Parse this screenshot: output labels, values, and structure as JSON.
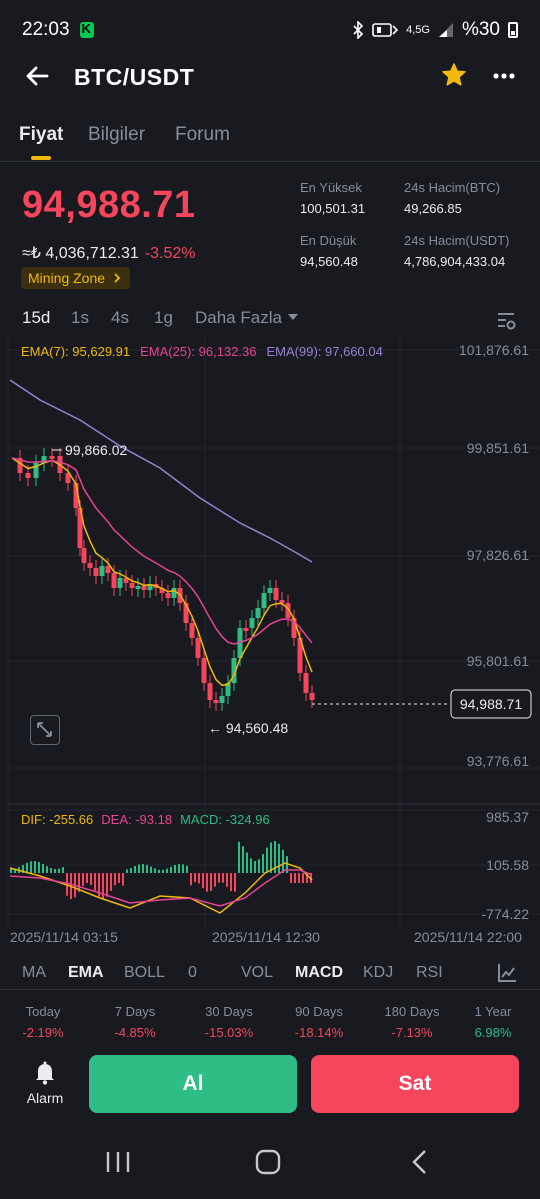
{
  "status_bar": {
    "time": "22:03",
    "network": "4,5G",
    "battery": "%30"
  },
  "header": {
    "title": "BTC/USDT"
  },
  "tabs": [
    {
      "label": "Fiyat",
      "active": true
    },
    {
      "label": "Bilgiler",
      "active": false
    },
    {
      "label": "Forum",
      "active": false
    }
  ],
  "price": {
    "last": "94,988.71",
    "fiat": "≈₺ 4,036,712.31",
    "change": "-3.52%",
    "mining_badge": "Mining Zone"
  },
  "stats": {
    "high_label": "En Yüksek",
    "high_value": "100,501.31",
    "low_label": "En Düşük",
    "low_value": "94,560.48",
    "vol_btc_label": "24s Hacim(BTC)",
    "vol_btc_value": "49,266.85",
    "vol_usdt_label": "24s Hacim(USDT)",
    "vol_usdt_value": "4,786,904,433.04"
  },
  "intervals": [
    {
      "label": "15d",
      "active": true
    },
    {
      "label": "1s",
      "active": false
    },
    {
      "label": "4s",
      "active": false
    },
    {
      "label": "1g",
      "active": false
    },
    {
      "label": "Daha Fazla",
      "active": false
    }
  ],
  "ema_legend": {
    "ema7": "EMA(7): 95,629.91",
    "ema25": "EMA(25): 96,132.36",
    "ema99": "EMA(99): 97,660.04"
  },
  "macd_legend": {
    "dif": "DIF: -255.66",
    "dea": "DEA: -93.18",
    "macd": "MACD: -324.96"
  },
  "price_axis": [
    "101,876.61",
    "99,851.61",
    "97,826.61",
    "95,801.61",
    "93,776.61"
  ],
  "macd_axis": [
    "985.37",
    "105.58",
    "-774.22"
  ],
  "time_axis": [
    "2025/11/14 03:15",
    "2025/11/14 12:30",
    "2025/11/14 22:00"
  ],
  "markers": {
    "high": "99,866.02",
    "low": "← 94,560.48",
    "last": "94,988.71"
  },
  "colors": {
    "up": "#2ebd85",
    "down": "#f6465d",
    "accent": "#f0b90b",
    "ema7": "#f0b90b",
    "ema25": "#e84393",
    "ema99": "#9b7fd4",
    "dif": "#f0b90b",
    "dea": "#e84393"
  },
  "indicators": {
    "main": [
      {
        "label": "MA",
        "active": false
      },
      {
        "label": "EMA",
        "active": true
      },
      {
        "label": "BOLL",
        "active": false
      },
      {
        "label": "0",
        "active": false
      }
    ],
    "sub": [
      {
        "label": "VOL",
        "active": false
      },
      {
        "label": "MACD",
        "active": true
      },
      {
        "label": "KDJ",
        "active": false
      },
      {
        "label": "RSI",
        "active": false
      }
    ]
  },
  "performance": [
    {
      "label": "Today",
      "value": "-2.19%",
      "direction": "down"
    },
    {
      "label": "7 Days",
      "value": "-4.85%",
      "direction": "down"
    },
    {
      "label": "30 Days",
      "value": "-15.03%",
      "direction": "down"
    },
    {
      "label": "90 Days",
      "value": "-18.14%",
      "direction": "down"
    },
    {
      "label": "180 Days",
      "value": "-7.13%",
      "direction": "down"
    },
    {
      "label": "1 Year",
      "value": "6.98%",
      "direction": "up"
    }
  ],
  "actions": {
    "alarm": "Alarm",
    "buy": "Al",
    "sell": "Sat"
  },
  "icons": [
    "back-arrow-icon",
    "star-icon",
    "more-icon",
    "settings-icon",
    "expand-icon",
    "chart-type-icon",
    "bell-icon",
    "recents-icon",
    "home-icon",
    "back-nav-icon"
  ]
}
